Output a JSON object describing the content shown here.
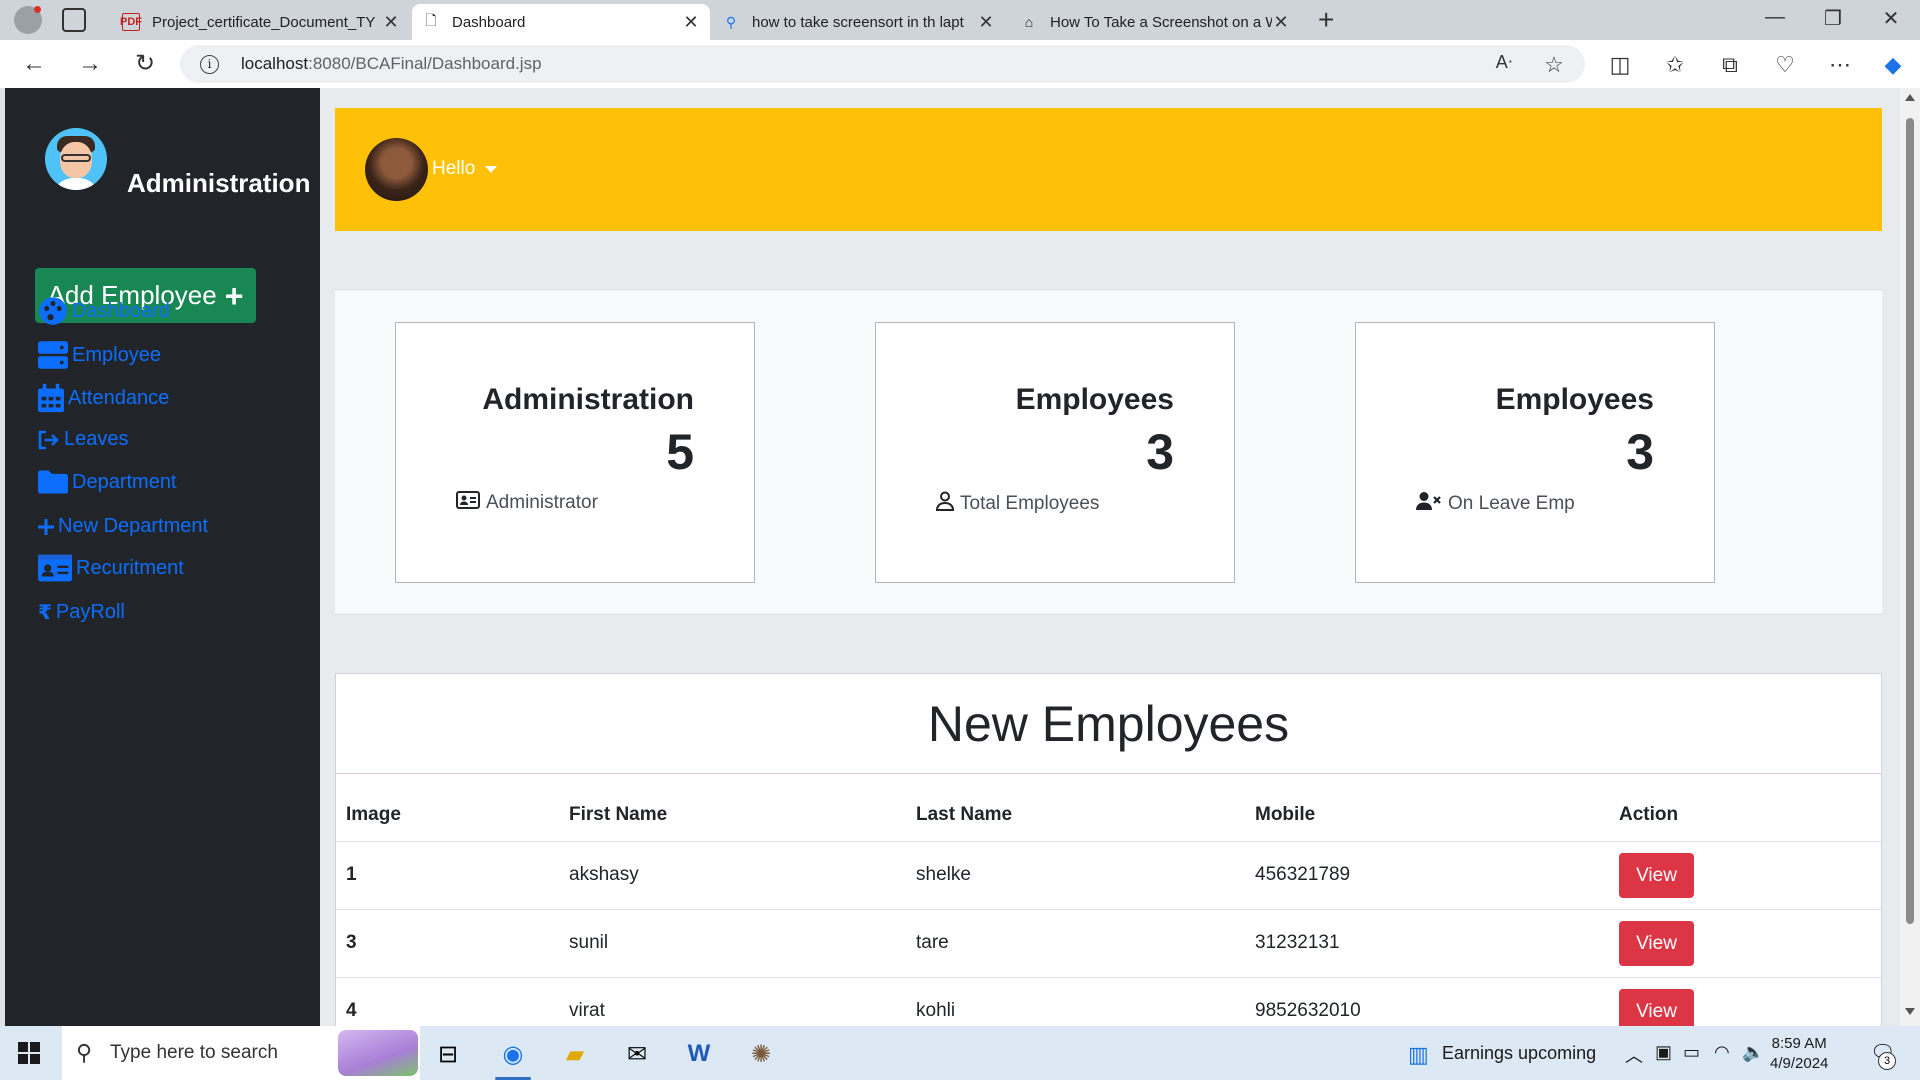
{
  "browser": {
    "tabs": [
      {
        "title": "Project_certificate_Document_TY",
        "icon": "pdf-icon",
        "active": false
      },
      {
        "title": "Dashboard",
        "icon": "page-icon",
        "active": true
      },
      {
        "title": "how to take screensort in th lapt",
        "icon": "search-icon",
        "active": false
      },
      {
        "title": "How To Take a Screenshot on a W",
        "icon": "house-icon",
        "active": false
      }
    ],
    "url_host": "localhost",
    "url_path": ":8080/BCAFinal/Dashboard.jsp"
  },
  "sidebar": {
    "title": "Administration",
    "add_button": "Add Employee",
    "items": [
      {
        "label": "Dashboard",
        "icon": "palette-icon"
      },
      {
        "label": "Employee",
        "icon": "server-icon"
      },
      {
        "label": "Attendance",
        "icon": "calendar-icon"
      },
      {
        "label": "Leaves",
        "icon": "sign-out-icon"
      },
      {
        "label": "Department",
        "icon": "folder-icon"
      },
      {
        "label": "New Department",
        "icon": "plus-icon"
      },
      {
        "label": "Recuritment",
        "icon": "id-card-icon"
      },
      {
        "label": "PayRoll",
        "icon": "rupee-icon"
      }
    ]
  },
  "topbar": {
    "greeting": "Hello"
  },
  "stats": [
    {
      "title": "Administration",
      "count": "5",
      "subtitle": "Administrator",
      "icon": "address-card-icon"
    },
    {
      "title": "Employees",
      "count": "3",
      "subtitle": "Total Employees",
      "icon": "user-icon"
    },
    {
      "title": "Employees",
      "count": "3",
      "subtitle": "On Leave Emp",
      "icon": "user-xmark-icon"
    }
  ],
  "new_employees": {
    "title": "New Employees",
    "columns": [
      "Image",
      "First Name",
      "Last Name",
      "Mobile",
      "Action"
    ],
    "rows": [
      {
        "image": "1",
        "first": "akshasy",
        "last": "shelke",
        "mobile": "456321789",
        "action": "View"
      },
      {
        "image": "3",
        "first": "sunil",
        "last": "tare",
        "mobile": "31232131",
        "action": "View"
      },
      {
        "image": "4",
        "first": "virat",
        "last": "kohli",
        "mobile": "9852632010",
        "action": "View"
      }
    ]
  },
  "taskbar": {
    "search_placeholder": "Type here to search",
    "news": "Earnings upcoming",
    "time": "8:59 AM",
    "date": "4/9/2024",
    "notifications": "3"
  },
  "colors": {
    "sidebar_bg": "#212529",
    "link": "#0d6efd",
    "add_button": "#198754",
    "topbar": "#ffc107",
    "view_button": "#dc3545"
  }
}
